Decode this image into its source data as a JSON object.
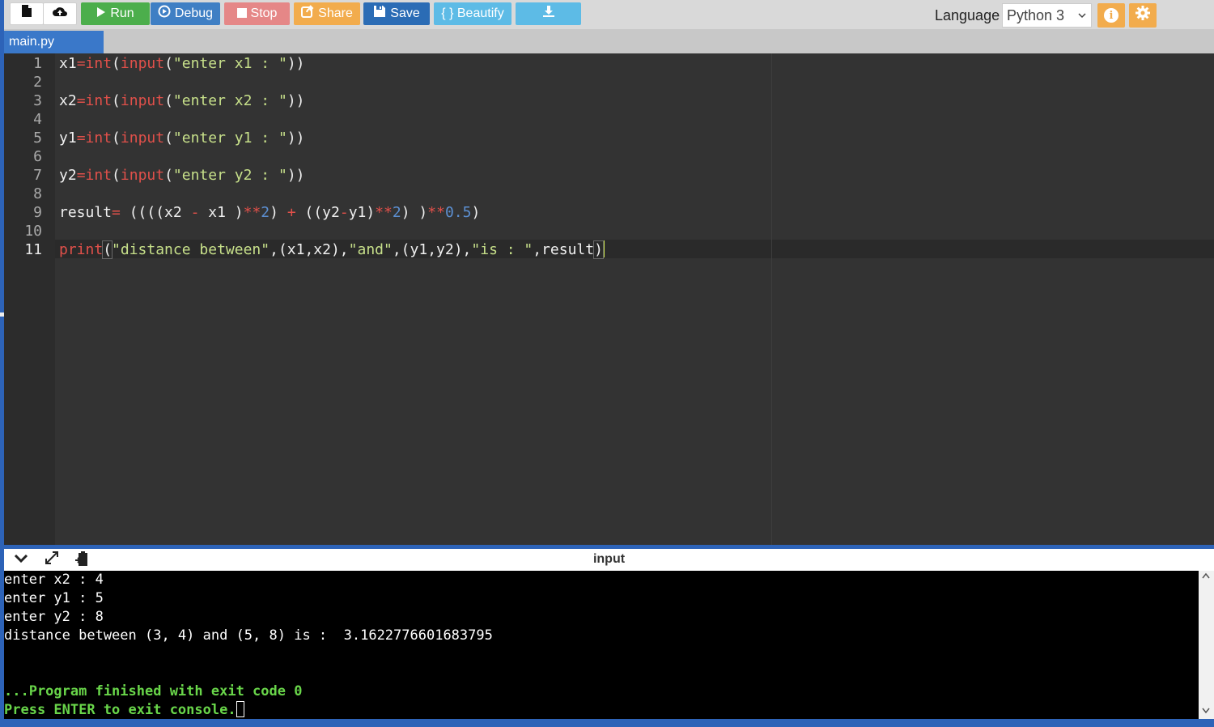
{
  "toolbar": {
    "run": "Run",
    "debug": "Debug",
    "stop": "Stop",
    "share": "Share",
    "save": "Save",
    "beautify": "{ } Beautify",
    "language_label": "Language",
    "language_value": "Python 3"
  },
  "file_tab": "main.py",
  "editor": {
    "line_numbers": [
      "1",
      "2",
      "3",
      "4",
      "5",
      "6",
      "7",
      "8",
      "9",
      "10",
      "11"
    ],
    "active_line": 11
  },
  "console": {
    "header_title": "input",
    "lines": [
      "enter x2 : 4",
      "enter y1 : 5",
      "enter y2 : 8",
      "distance between (3, 4) and (5, 8) is :  3.1622776601683795"
    ],
    "finished": "...Program finished with exit code 0",
    "press_enter": "Press ENTER to exit console."
  },
  "colors": {
    "run": "#4cae4c",
    "debug": "#3f7fc4",
    "stop": "#e58787",
    "share": "#f2ac4d",
    "save": "#2b6cb5",
    "beautify": "#5dbbe6",
    "editor_bg": "#333333",
    "keyword": "#e1504a",
    "string": "#c7e08a",
    "number": "#5c8fd1",
    "console_green": "#69d64a"
  },
  "icons": [
    "new-file-icon",
    "upload-icon",
    "play-icon",
    "debug-icon",
    "stop-icon",
    "share-icon",
    "save-icon",
    "download-icon",
    "info-icon",
    "gear-icon",
    "collapse-icon",
    "expand-icon",
    "clipboard-icon"
  ]
}
